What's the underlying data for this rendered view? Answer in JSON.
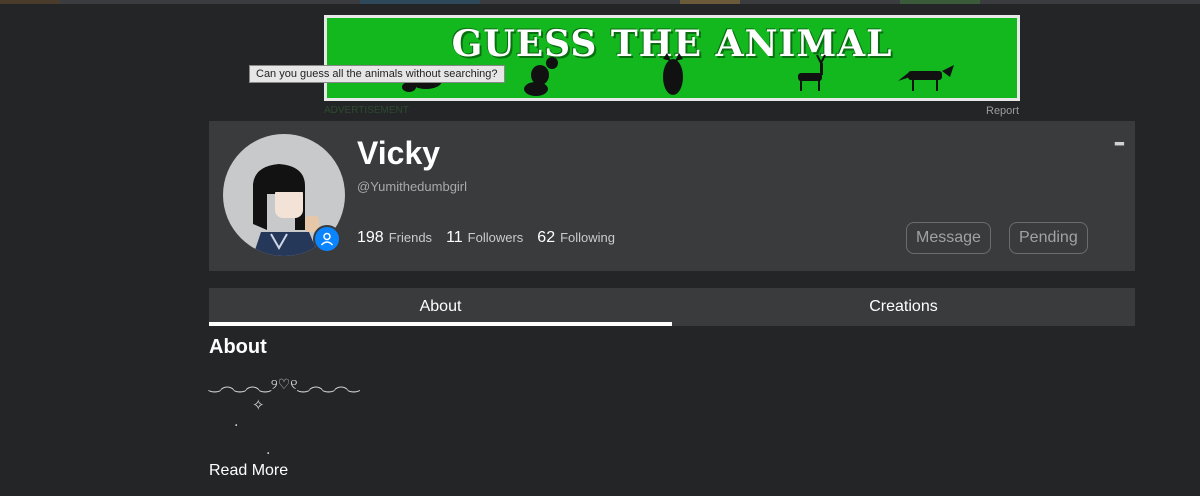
{
  "colors": {
    "background": "#232527",
    "card": "#393b3d",
    "ad_green": "#12b81e",
    "badge_blue": "#0a84ff"
  },
  "ad": {
    "title": "GUESS THE ANIMAL",
    "tooltip": "Can you guess all the animals without searching?",
    "label": "ADVERTISEMENT",
    "report": "Report"
  },
  "profile": {
    "display_name": "Vicky",
    "username": "@Yumithedumbgirl",
    "stats": {
      "friends_count": "198",
      "friends_label": "Friends",
      "followers_count": "11",
      "followers_label": "Followers",
      "following_count": "62",
      "following_label": "Following"
    },
    "buttons": {
      "message": "Message",
      "pending": "Pending"
    },
    "more_icon": "more-dots-icon",
    "badge_icon": "person-icon"
  },
  "tabs": [
    {
      "label": "About",
      "active": true
    },
    {
      "label": "Creations",
      "active": false
    }
  ],
  "about": {
    "heading": "About",
    "lines": [
      "‿︵‿︵‿୨♡୧‿︵‿︵‿",
      "✧",
      "·",
      "."
    ],
    "read_more": "Read More"
  }
}
